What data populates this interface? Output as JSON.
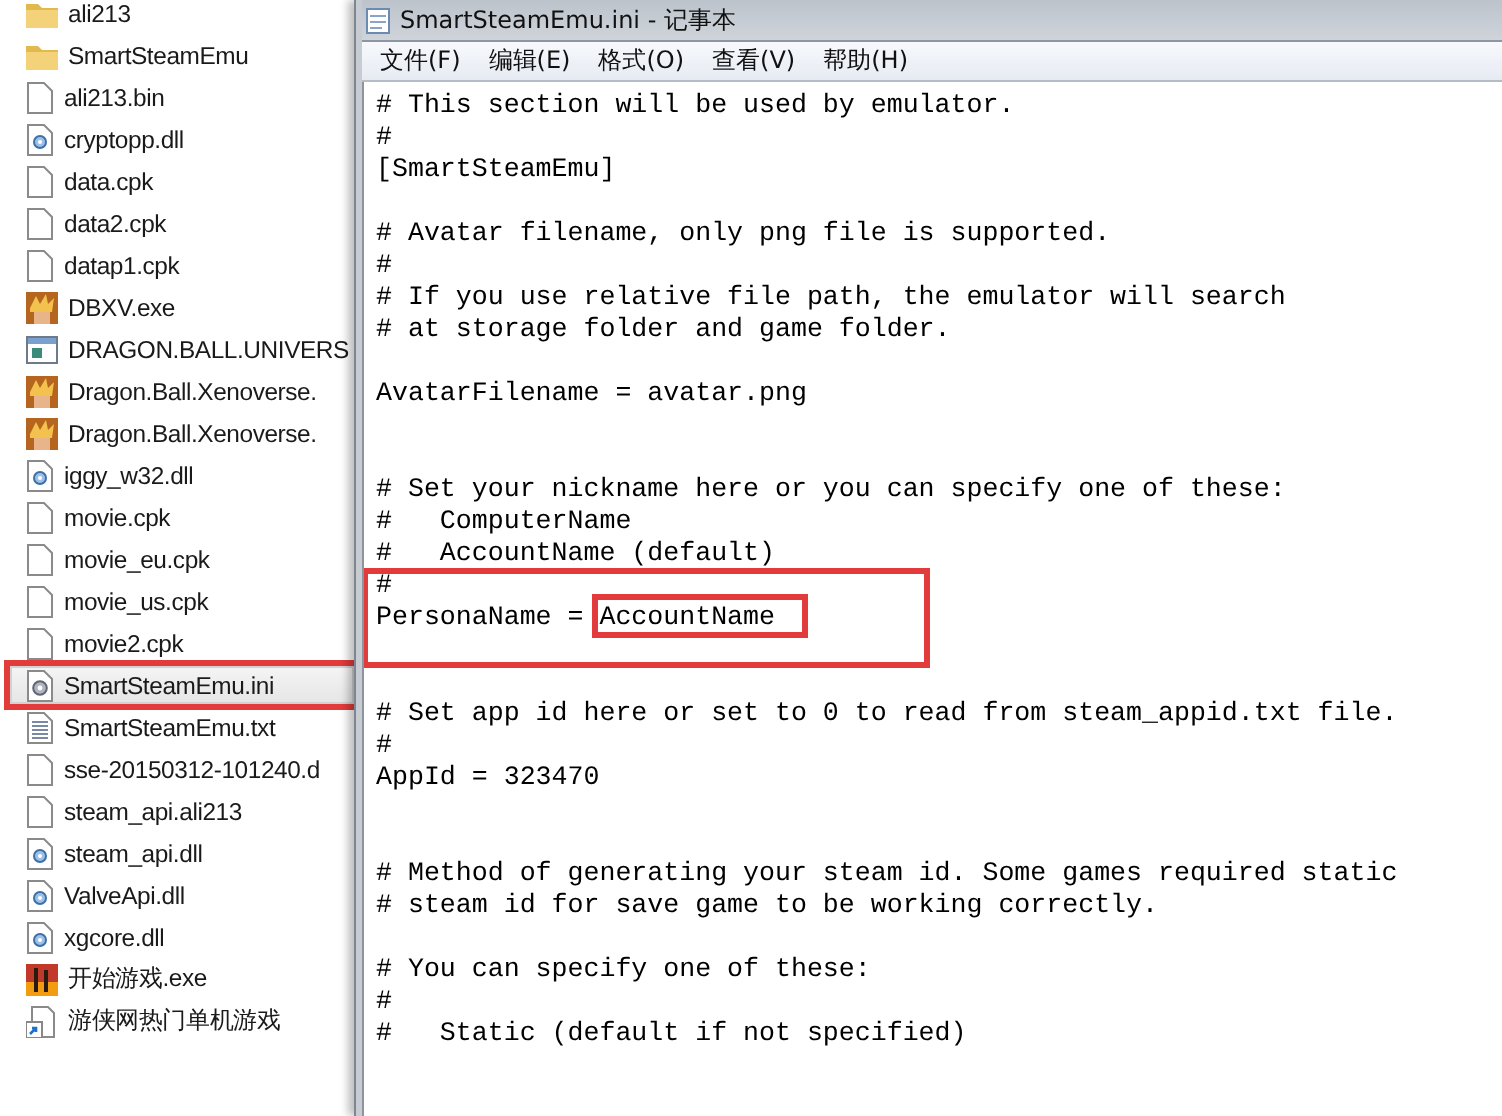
{
  "files": [
    {
      "name": "ali213",
      "kind": "folder",
      "selected": false,
      "outlined": false
    },
    {
      "name": "SmartSteamEmu",
      "kind": "folder",
      "selected": false,
      "outlined": false
    },
    {
      "name": "ali213.bin",
      "kind": "file",
      "selected": false,
      "outlined": false
    },
    {
      "name": "cryptopp.dll",
      "kind": "dll",
      "selected": false,
      "outlined": false
    },
    {
      "name": "data.cpk",
      "kind": "file",
      "selected": false,
      "outlined": false
    },
    {
      "name": "data2.cpk",
      "kind": "file",
      "selected": false,
      "outlined": false
    },
    {
      "name": "datap1.cpk",
      "kind": "file",
      "selected": false,
      "outlined": false
    },
    {
      "name": "DBXV.exe",
      "kind": "game",
      "selected": false,
      "outlined": false
    },
    {
      "name": "DRAGON.BALL.UNIVERS",
      "kind": "app",
      "selected": false,
      "outlined": false
    },
    {
      "name": "Dragon.Ball.Xenoverse.",
      "kind": "game",
      "selected": false,
      "outlined": false
    },
    {
      "name": "Dragon.Ball.Xenoverse.",
      "kind": "game",
      "selected": false,
      "outlined": false
    },
    {
      "name": "iggy_w32.dll",
      "kind": "dll",
      "selected": false,
      "outlined": false
    },
    {
      "name": "movie.cpk",
      "kind": "file",
      "selected": false,
      "outlined": false
    },
    {
      "name": "movie_eu.cpk",
      "kind": "file",
      "selected": false,
      "outlined": false
    },
    {
      "name": "movie_us.cpk",
      "kind": "file",
      "selected": false,
      "outlined": false
    },
    {
      "name": "movie2.cpk",
      "kind": "file",
      "selected": false,
      "outlined": false
    },
    {
      "name": "SmartSteamEmu.ini",
      "kind": "ini",
      "selected": true,
      "outlined": true
    },
    {
      "name": "SmartSteamEmu.txt",
      "kind": "txt",
      "selected": false,
      "outlined": false
    },
    {
      "name": "sse-20150312-101240.d",
      "kind": "file",
      "selected": false,
      "outlined": false
    },
    {
      "name": "steam_api.ali213",
      "kind": "file",
      "selected": false,
      "outlined": false
    },
    {
      "name": "steam_api.dll",
      "kind": "dll",
      "selected": false,
      "outlined": false
    },
    {
      "name": "ValveApi.dll",
      "kind": "dll",
      "selected": false,
      "outlined": false
    },
    {
      "name": "xgcore.dll",
      "kind": "dll",
      "selected": false,
      "outlined": false
    },
    {
      "name": "开始游戏.exe",
      "kind": "launcher",
      "selected": false,
      "outlined": false
    },
    {
      "name": "游侠网热门单机游戏",
      "kind": "shortcut",
      "selected": false,
      "outlined": false
    }
  ],
  "notepad": {
    "title": "SmartSteamEmu.ini - 记事本",
    "menu": [
      "文件(F)",
      "编辑(E)",
      "格式(O)",
      "查看(V)",
      "帮助(H)"
    ],
    "lines": [
      {
        "kind": "text",
        "text": "# This section will be used by emulator."
      },
      {
        "kind": "text",
        "text": "#"
      },
      {
        "kind": "text",
        "text": "[SmartSteamEmu]"
      },
      {
        "kind": "blank"
      },
      {
        "kind": "text",
        "text": "# Avatar filename, only png file is supported."
      },
      {
        "kind": "text",
        "text": "#"
      },
      {
        "kind": "text",
        "text": "# If you use relative file path, the emulator will search"
      },
      {
        "kind": "text",
        "text": "# at storage folder and game folder."
      },
      {
        "kind": "blank"
      },
      {
        "kind": "text",
        "text": "AvatarFilename = avatar.png"
      },
      {
        "kind": "blank"
      },
      {
        "kind": "blank"
      },
      {
        "kind": "text",
        "text": "# Set your nickname here or you can specify one of these:"
      },
      {
        "kind": "text",
        "text": "#   ComputerName"
      },
      {
        "kind": "text",
        "text": "#   AccountName (default)"
      },
      {
        "kind": "framed",
        "lines": [
          {
            "kind": "text",
            "text": "#"
          },
          {
            "kind": "setting",
            "text": "PersonaName = ",
            "value": "AccountName"
          },
          {
            "kind": "blank"
          }
        ]
      },
      {
        "kind": "blank"
      },
      {
        "kind": "text",
        "text": "# Set app id here or set to 0 to read from steam_appid.txt file."
      },
      {
        "kind": "text",
        "text": "#"
      },
      {
        "kind": "text",
        "text": "AppId = 323470"
      },
      {
        "kind": "blank"
      },
      {
        "kind": "blank"
      },
      {
        "kind": "text",
        "text": "# Method of generating your steam id. Some games required static"
      },
      {
        "kind": "text",
        "text": "# steam id for save game to be working correctly."
      },
      {
        "kind": "blank"
      },
      {
        "kind": "text",
        "text": "# You can specify one of these:"
      },
      {
        "kind": "text",
        "text": "#"
      },
      {
        "kind": "text",
        "text": "#   Static (default if not specified)"
      }
    ]
  }
}
